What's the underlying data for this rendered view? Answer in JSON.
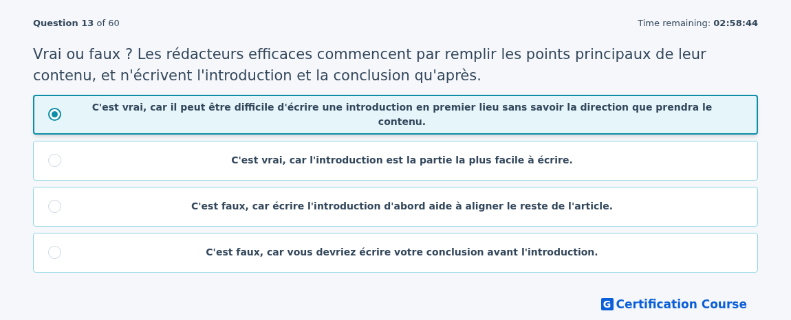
{
  "header": {
    "progress": "**Question 13** of 60",
    "timer": "Time remaining: **02:58:44**"
  },
  "question": "Vrai ou faux ? Les rédacteurs efficaces commencent par remplir les points principaux de leur contenu, et n'écrivent l'introduction et la conclusion qu'après.",
  "options": [
    {
      "label": "C'est vrai, car il peut être difficile d'écrire une introduction en premier lieu sans savoir la direction que prendra le contenu.",
      "selected": true
    },
    {
      "label": "C'est vrai, car l'introduction est la partie la plus facile à écrire.",
      "selected": false
    },
    {
      "label": "C'est faux, car écrire l'introduction d'abord aide à aligner le reste de l'article.",
      "selected": false
    },
    {
      "label": "C'est faux, car vous devriez écrire votre conclusion avant l'introduction.",
      "selected": false
    }
  ],
  "brand": {
    "mark": "G",
    "name": "Certification Course"
  }
}
